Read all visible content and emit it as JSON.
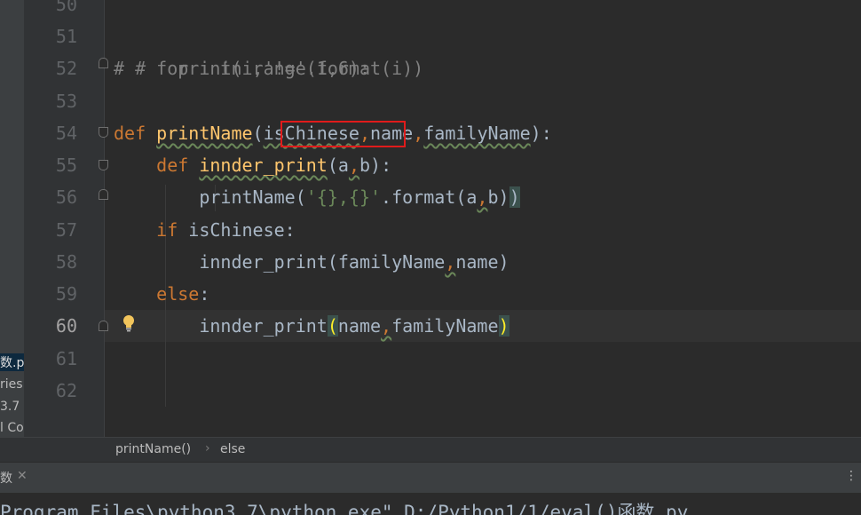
{
  "project_panel": {
    "items": [
      {
        "label": "数.p",
        "selected": true
      },
      {
        "label": "ries",
        "selected": false
      },
      {
        "label": "3.7 >",
        "selected": false
      },
      {
        "label": "l Co",
        "selected": false
      }
    ]
  },
  "editor": {
    "line_numbers": [
      "50",
      "51",
      "52",
      "53",
      "54",
      "55",
      "56",
      "57",
      "58",
      "59",
      "60",
      "61",
      "62"
    ],
    "current_line": "60",
    "lines": {
      "l51": "# for i in range(1,6):",
      "l52_hash": "#",
      "l52_rest": "     print(i,'!='.format(i))",
      "l54_def": "def",
      "l54_name": "printName",
      "l54_open": "(",
      "l54_p1": "isChinese",
      "l54_c1": ",",
      "l54_p2": "name",
      "l54_c2": ",",
      "l54_p3": "familyName",
      "l54_close": "):",
      "l55_def": "def",
      "l55_name": "innder_print",
      "l55_open": "(",
      "l55_a": "a",
      "l55_c": ",",
      "l55_b": "b",
      "l55_close": "):",
      "l56_call": "printName(",
      "l56_str": "'{},{}'",
      "l56_fmt": ".format(",
      "l56_a": "a",
      "l56_c": ",",
      "l56_b": "b",
      "l56_close1": ")",
      "l56_close2": ")",
      "l57_if": "if",
      "l57_rest": " isChinese:",
      "l58_call": "innder_print(familyName",
      "l58_c": ",",
      "l58_rest": "name)",
      "l59_else": "else",
      "l59_colon": ":",
      "l60_call": "innder_print",
      "l60_open": "(",
      "l60_p1": "name",
      "l60_c": ",",
      "l60_p2": "familyName",
      "l60_close": ")"
    }
  },
  "breadcrumb": {
    "items": [
      "printName()",
      "else"
    ],
    "separator": "›"
  },
  "run_panel": {
    "tab_label": "数",
    "close_glyph": "✕",
    "menu_glyph": "⋮",
    "console_line": "Program Files\\python3.7\\python.exe\" D:/Python1/1/eval()函数.py"
  },
  "colors": {
    "background": "#2b2b2b",
    "keyword": "#cc7832",
    "function": "#ffc66d",
    "string": "#6a8759",
    "comment": "#808080",
    "highlight_box": "#e01b1b"
  }
}
